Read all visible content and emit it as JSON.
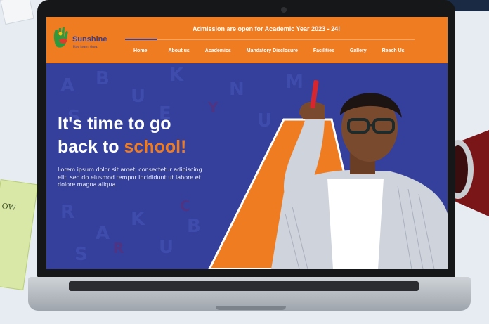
{
  "logo": {
    "name": "Sunshine",
    "tagline": "Play. Learn. Grow."
  },
  "header": {
    "announcement": "Admission are open for Academic Year 2023 - 24!"
  },
  "nav": {
    "items": [
      {
        "label": "Home"
      },
      {
        "label": "About us"
      },
      {
        "label": "Academics"
      },
      {
        "label": "Mandatory Disclosure"
      },
      {
        "label": "Facilities"
      },
      {
        "label": "Gallery"
      },
      {
        "label": "Reach Us"
      }
    ]
  },
  "hero": {
    "title_line1": "It's time to go",
    "title_line2_prefix": "back to ",
    "title_line2_accent": "school!",
    "body": "Lorem ipsum dolor sit amet, consectetur adipiscing elit, sed do eiusmod tempor incididunt ut labore et dolore magna aliqua."
  },
  "background": {
    "book_text": "OW"
  },
  "colors": {
    "brand_orange": "#f07c22",
    "brand_blue": "#34409b",
    "white": "#ffffff"
  }
}
